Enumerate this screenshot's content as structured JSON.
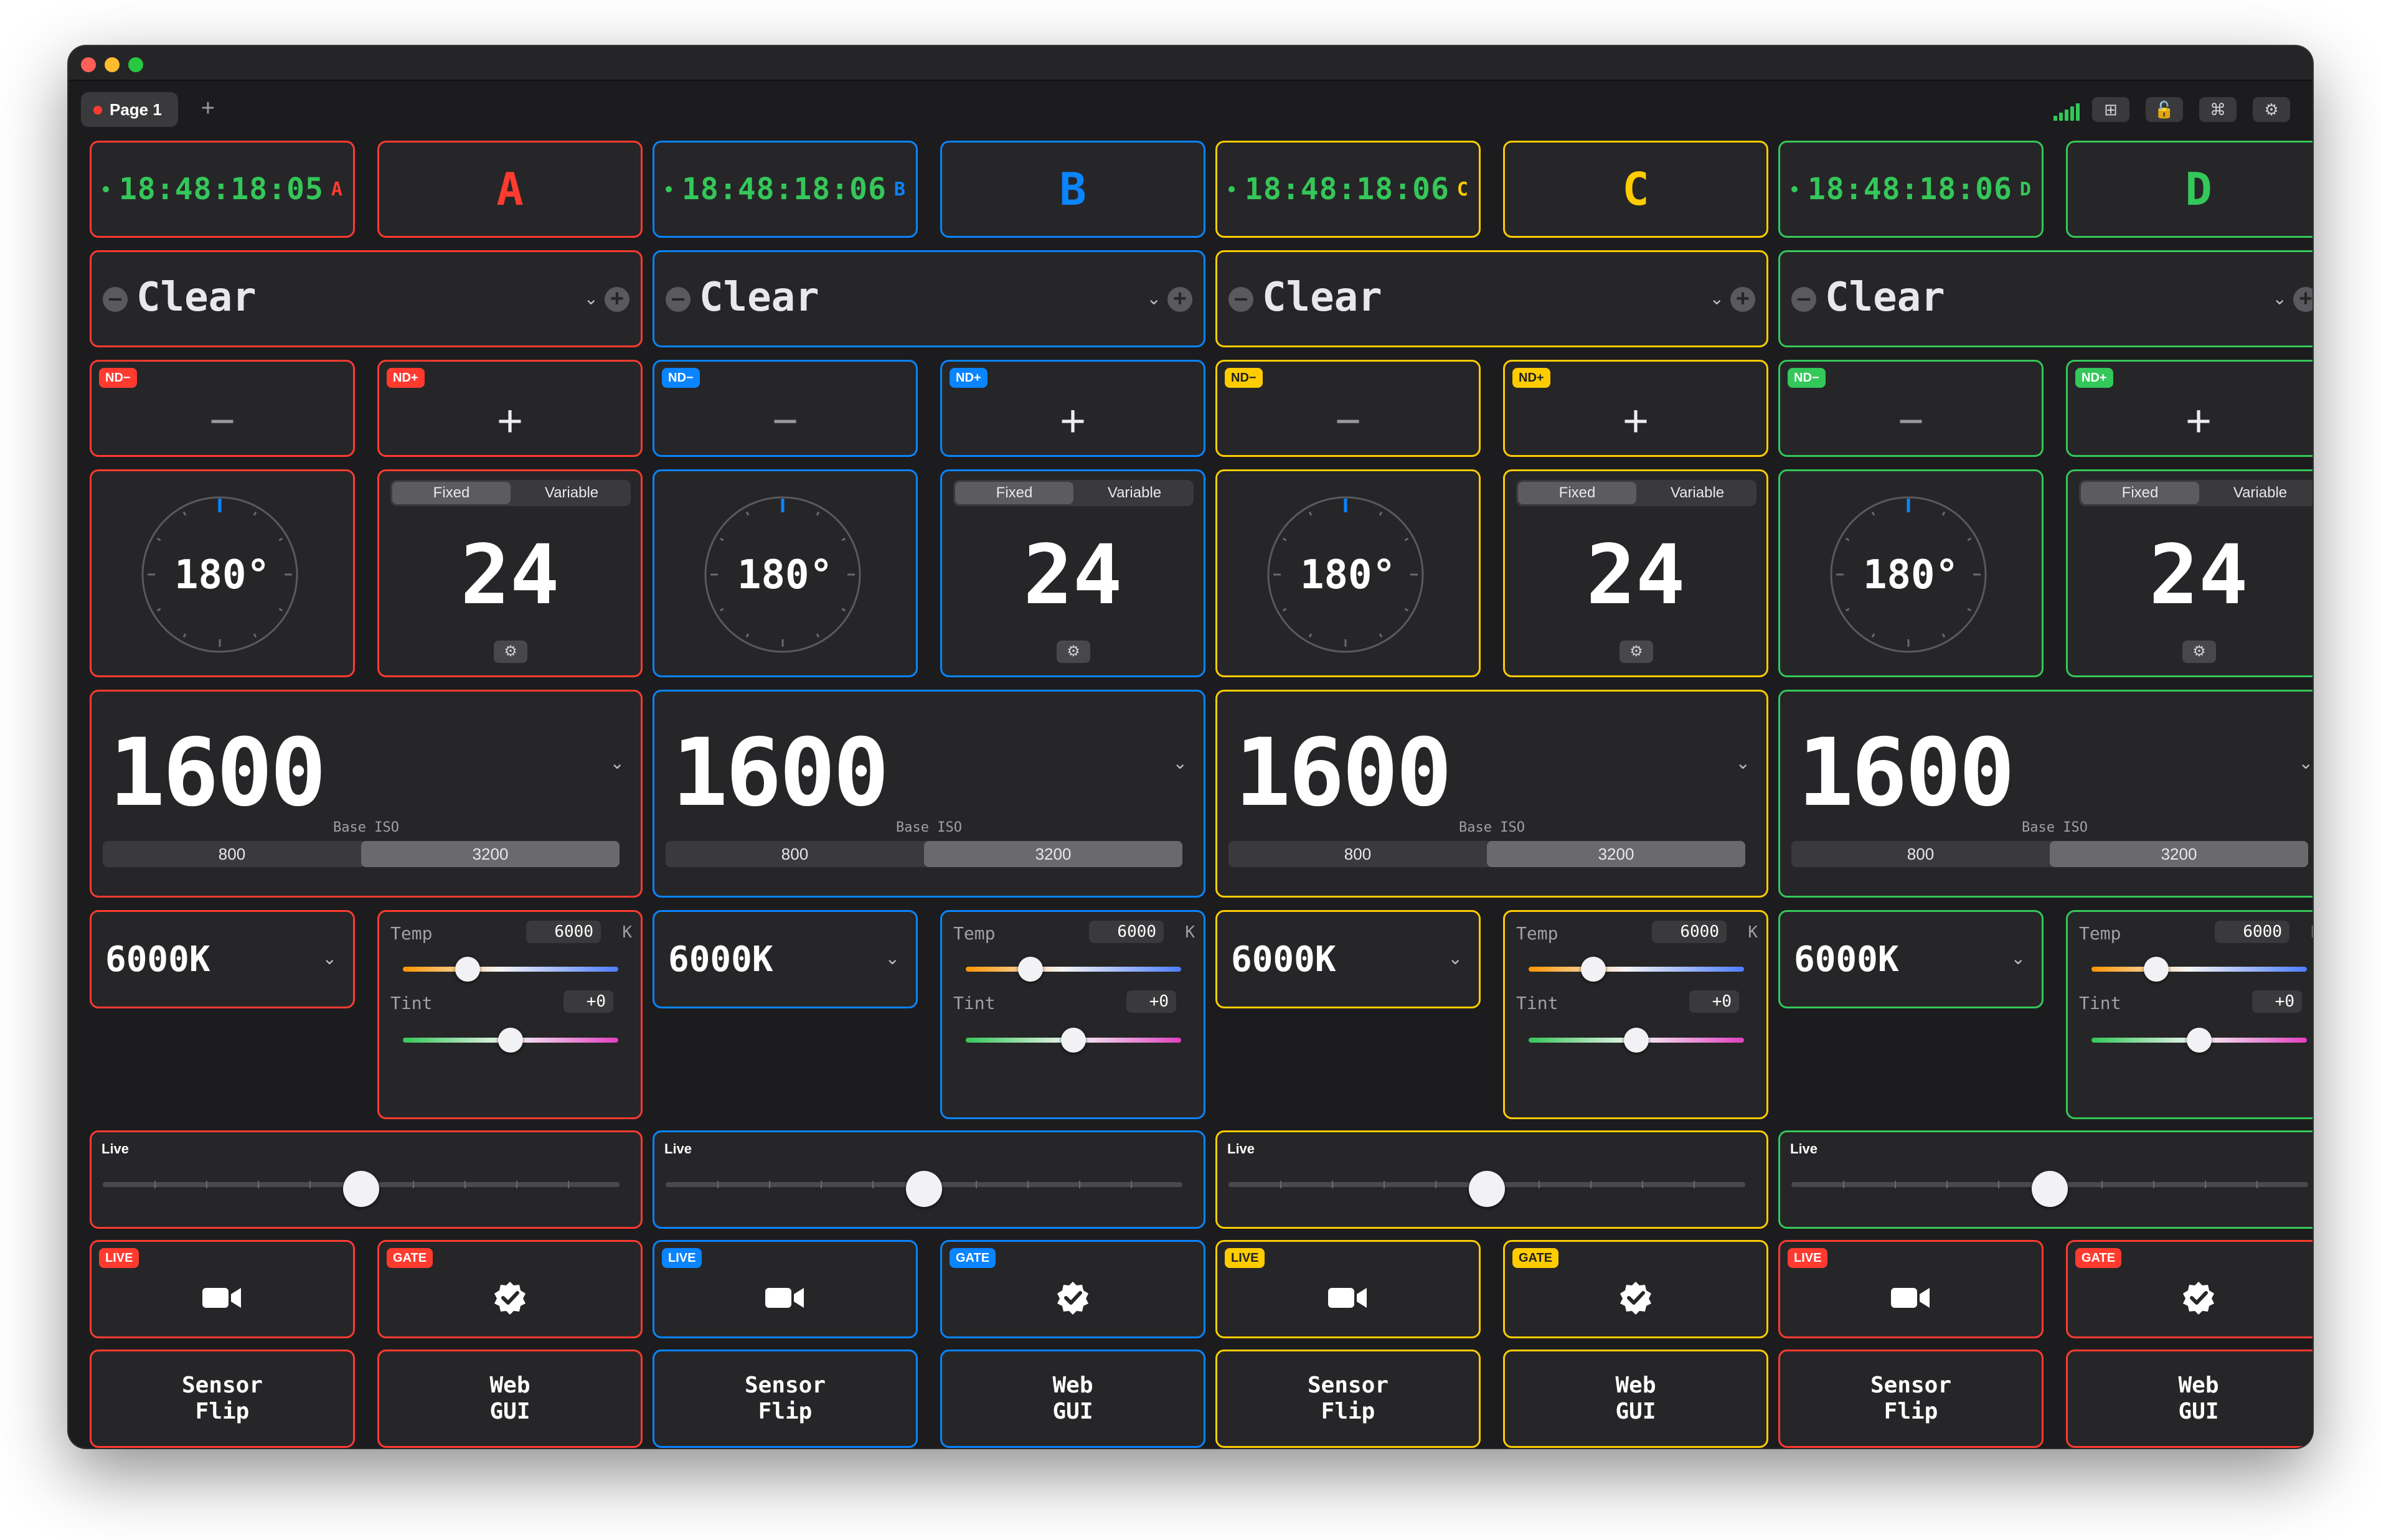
{
  "window": {
    "tab_label": "Page 1",
    "add_tab_label": "+",
    "toolbar_icons": [
      "signal-bars-icon",
      "grid-icon",
      "lock-open-icon",
      "command-icon",
      "settings-icon"
    ]
  },
  "colors": {
    "red": "#ff3b30",
    "blue": "#0a84ff",
    "yellow": "#ffcc00",
    "green": "#34c759"
  },
  "columns": [
    {
      "letter": "A",
      "color": "#ff3b30",
      "timecode": "18:48:18:05",
      "clock_letter": "A",
      "preset": "Clear",
      "nd_minus": "ND−",
      "nd_plus": "ND+",
      "minus_symbol": "−",
      "plus_symbol": "+",
      "shutter": "180°",
      "fps_modes": [
        "Fixed",
        "Variable"
      ],
      "fps_mode_selected": "Fixed",
      "fps": "24",
      "iso": "1600",
      "base_iso_label": "Base ISO",
      "base_iso_options": [
        "800",
        "3200"
      ],
      "base_iso_selected": "3200",
      "wb": "6000K",
      "temp_label": "Temp",
      "temp_value": "6000",
      "temp_unit": "K",
      "temp_fraction": 0.3,
      "tint_label": "Tint",
      "tint_value": "+0",
      "tint_fraction": 0.5,
      "live_label": "Live",
      "live_fraction": 0.5,
      "live_tag": "LIVE",
      "live_tag_color": "#ff3b30",
      "gate_tag": "GATE",
      "gate_tag_color": "#ff3b30",
      "sensor_flip": [
        "Sensor",
        "Flip"
      ],
      "web_gui": [
        "Web",
        "GUI"
      ],
      "border_main": "#ff3b30",
      "border_tags": "#ff3b30",
      "border_bottom": "#ff3b30"
    },
    {
      "letter": "B",
      "color": "#0a84ff",
      "timecode": "18:48:18:06",
      "clock_letter": "B",
      "preset": "Clear",
      "nd_minus": "ND−",
      "nd_plus": "ND+",
      "minus_symbol": "−",
      "plus_symbol": "+",
      "shutter": "180°",
      "fps_modes": [
        "Fixed",
        "Variable"
      ],
      "fps_mode_selected": "Fixed",
      "fps": "24",
      "iso": "1600",
      "base_iso_label": "Base ISO",
      "base_iso_options": [
        "800",
        "3200"
      ],
      "base_iso_selected": "3200",
      "wb": "6000K",
      "temp_label": "Temp",
      "temp_value": "6000",
      "temp_unit": "K",
      "temp_fraction": 0.3,
      "tint_label": "Tint",
      "tint_value": "+0",
      "tint_fraction": 0.5,
      "live_label": "Live",
      "live_fraction": 0.5,
      "live_tag": "LIVE",
      "live_tag_color": "#0a84ff",
      "gate_tag": "GATE",
      "gate_tag_color": "#0a84ff",
      "sensor_flip": [
        "Sensor",
        "Flip"
      ],
      "web_gui": [
        "Web",
        "GUI"
      ],
      "border_main": "#0a84ff",
      "border_tags": "#0a84ff",
      "border_bottom": "#0a84ff"
    },
    {
      "letter": "C",
      "color": "#ffcc00",
      "timecode": "18:48:18:06",
      "clock_letter": "C",
      "preset": "Clear",
      "nd_minus": "ND−",
      "nd_plus": "ND+",
      "minus_symbol": "−",
      "plus_symbol": "+",
      "shutter": "180°",
      "fps_modes": [
        "Fixed",
        "Variable"
      ],
      "fps_mode_selected": "Fixed",
      "fps": "24",
      "iso": "1600",
      "base_iso_label": "Base ISO",
      "base_iso_options": [
        "800",
        "3200"
      ],
      "base_iso_selected": "3200",
      "wb": "6000K",
      "temp_label": "Temp",
      "temp_value": "6000",
      "temp_unit": "K",
      "temp_fraction": 0.3,
      "tint_label": "Tint",
      "tint_value": "+0",
      "tint_fraction": 0.5,
      "live_label": "Live",
      "live_fraction": 0.5,
      "live_tag": "LIVE",
      "live_tag_color": "#ffcc00",
      "gate_tag": "GATE",
      "gate_tag_color": "#ffcc00",
      "sensor_flip": [
        "Sensor",
        "Flip"
      ],
      "web_gui": [
        "Web",
        "GUI"
      ],
      "border_main": "#ffcc00",
      "border_tags": "#ffcc00",
      "border_bottom": "#ffcc00"
    },
    {
      "letter": "D",
      "color": "#34c759",
      "timecode": "18:48:18:06",
      "clock_letter": "D",
      "preset": "Clear",
      "nd_minus": "ND−",
      "nd_plus": "ND+",
      "minus_symbol": "−",
      "plus_symbol": "+",
      "shutter": "180°",
      "fps_modes": [
        "Fixed",
        "Variable"
      ],
      "fps_mode_selected": "Fixed",
      "fps": "24",
      "iso": "1600",
      "base_iso_label": "Base ISO",
      "base_iso_options": [
        "800",
        "3200"
      ],
      "base_iso_selected": "3200",
      "wb": "6000K",
      "temp_label": "Temp",
      "temp_value": "6000",
      "temp_unit": "K",
      "temp_fraction": 0.3,
      "tint_label": "Tint",
      "tint_value": "+0",
      "tint_fraction": 0.5,
      "live_label": "Live",
      "live_fraction": 0.5,
      "live_tag": "LIVE",
      "live_tag_color": "#ff3b30",
      "gate_tag": "GATE",
      "gate_tag_color": "#ff3b30",
      "sensor_flip": [
        "Sensor",
        "Flip"
      ],
      "web_gui": [
        "Web",
        "GUI"
      ],
      "border_main": "#34c759",
      "border_tags": "#ff3b30",
      "border_bottom": "#ff3b30"
    }
  ]
}
